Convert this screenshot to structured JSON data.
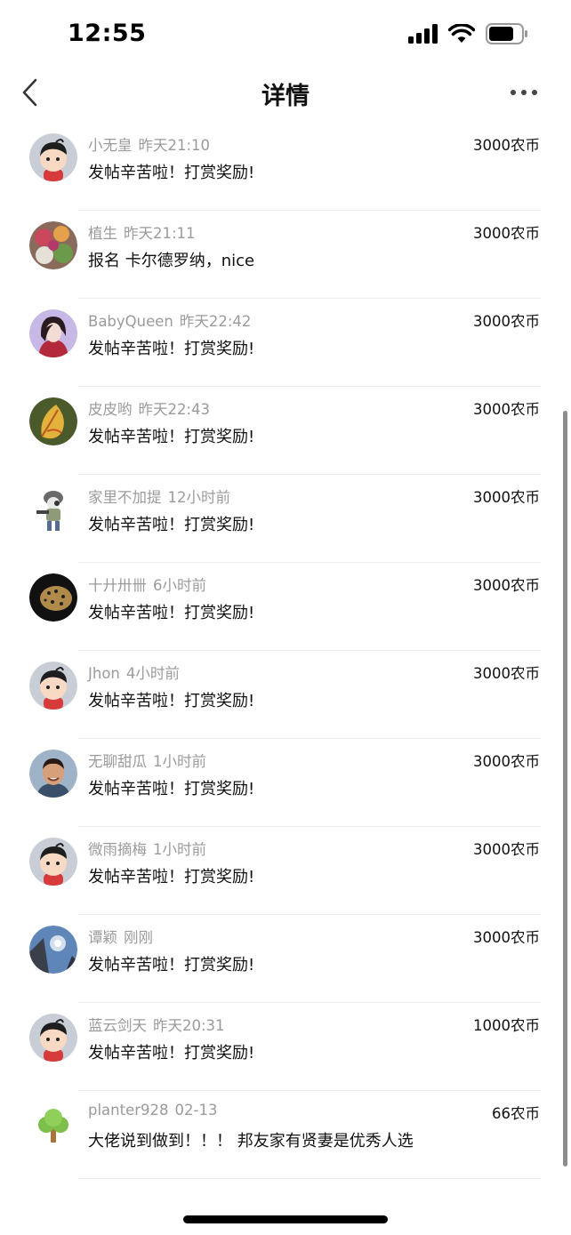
{
  "status_bar": {
    "time": "12:55"
  },
  "nav": {
    "title": "详情"
  },
  "rows": [
    {
      "name": "小无皇",
      "time": "昨天21:10",
      "message": "发帖辛苦啦！打赏奖励!",
      "amount": "3000农币",
      "avatar_icon": "cartoon-boy-icon"
    },
    {
      "name": "植生",
      "time": "昨天21:11",
      "message": "报名 卡尔德罗纳，nice",
      "amount": "3000农币",
      "avatar_icon": "food-photo-icon"
    },
    {
      "name": "BabyQueen",
      "time": "昨天22:42",
      "message": "发帖辛苦啦！打赏奖励!",
      "amount": "3000农币",
      "avatar_icon": "woman-photo-icon"
    },
    {
      "name": "皮皮哟",
      "time": "昨天22:43",
      "message": "发帖辛苦啦！打赏奖励!",
      "amount": "3000农币",
      "avatar_icon": "leaf-photo-icon"
    },
    {
      "name": "家里不加提",
      "time": "12小时前",
      "message": "发帖辛苦啦！打赏奖励!",
      "amount": "3000农币",
      "avatar_icon": "soldier-icon"
    },
    {
      "name": "十廾卅卌",
      "time": "6小时前",
      "message": "发帖辛苦啦！打赏奖励!",
      "amount": "3000农币",
      "avatar_icon": "leopard-photo-icon"
    },
    {
      "name": "Jhon",
      "time": "4小时前",
      "message": "发帖辛苦啦！打赏奖励!",
      "amount": "3000农币",
      "avatar_icon": "cartoon-boy-icon"
    },
    {
      "name": "无聊甜瓜",
      "time": "1小时前",
      "message": "发帖辛苦啦！打赏奖励!",
      "amount": "3000农币",
      "avatar_icon": "man-photo-icon"
    },
    {
      "name": "微雨摘梅",
      "time": "1小时前",
      "message": "发帖辛苦啦！打赏奖励!",
      "amount": "3000农币",
      "avatar_icon": "cartoon-boy-icon"
    },
    {
      "name": "谭颖",
      "time": "刚刚",
      "message": "发帖辛苦啦！打赏奖励!",
      "amount": "3000农币",
      "avatar_icon": "sky-photo-icon"
    },
    {
      "name": "蓝云剑天",
      "time": "昨天20:31",
      "message": "发帖辛苦啦！打赏奖励!",
      "amount": "1000农币",
      "avatar_icon": "cartoon-boy-icon"
    },
    {
      "name": "planter928",
      "time": "02-13",
      "message": "大佬说到做到！！！ 邦友家有贤妻是优秀人选",
      "amount": "66农币",
      "avatar_icon": "tree-icon"
    }
  ],
  "colors": {
    "meta_text": "#9b9b9b",
    "primary_text": "#111111",
    "divider": "#ececec",
    "background": "#ffffff"
  }
}
